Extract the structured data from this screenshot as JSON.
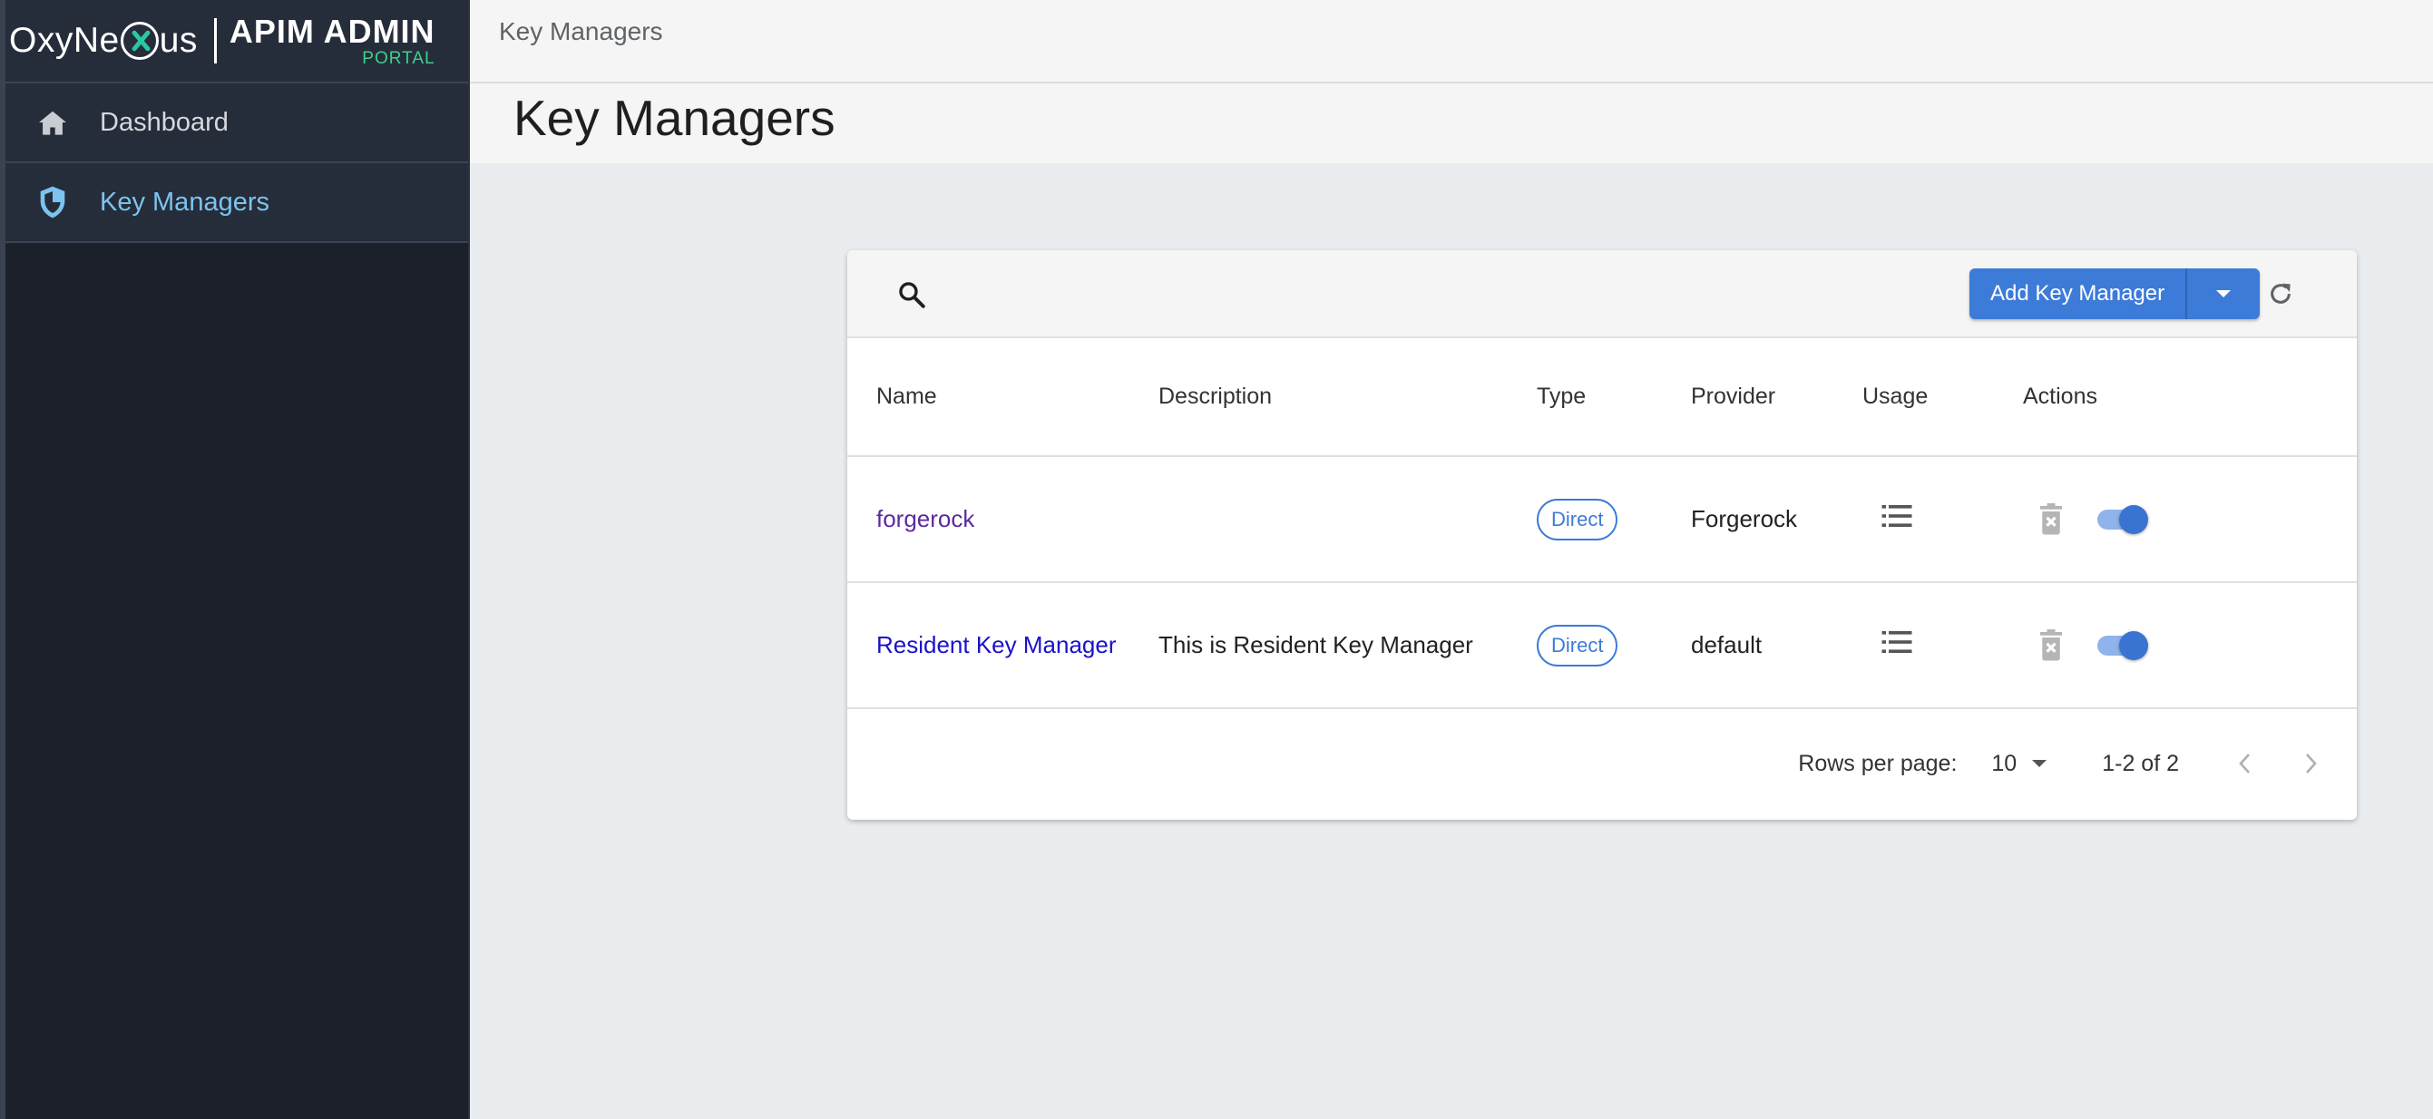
{
  "brand": {
    "logo_text_pre": "OxyNe",
    "logo_text_post": "us",
    "title": "APIM ADMIN",
    "subtitle": "PORTAL"
  },
  "sidebar": {
    "items": [
      {
        "label": "Dashboard",
        "icon": "home-icon",
        "active": false
      },
      {
        "label": "Key Managers",
        "icon": "shield-icon",
        "active": true
      }
    ]
  },
  "header": {
    "breadcrumb": "Key Managers",
    "page_title": "Key Managers"
  },
  "toolbar": {
    "search_icon": "search-icon",
    "add_label": "Add Key Manager",
    "dropdown_icon": "caret-down-icon",
    "refresh_icon": "refresh-icon"
  },
  "table": {
    "columns": [
      "Name",
      "Description",
      "Type",
      "Provider",
      "Usage",
      "Actions"
    ],
    "rows": [
      {
        "name": "forgerock",
        "description": "",
        "type": "Direct",
        "provider": "Forgerock",
        "enabled": true
      },
      {
        "name": "Resident Key Manager",
        "description": "This is Resident Key Manager",
        "type": "Direct",
        "provider": "default",
        "enabled": true
      }
    ]
  },
  "pagination": {
    "rows_per_page_label": "Rows per page:",
    "rows_per_page": "10",
    "range": "1-2 of 2"
  },
  "colors": {
    "accent": "#3c7bd8",
    "sidebar_bg": "#1b202b",
    "active_nav": "#7cc3f0",
    "brand_green": "#3fd08c"
  }
}
